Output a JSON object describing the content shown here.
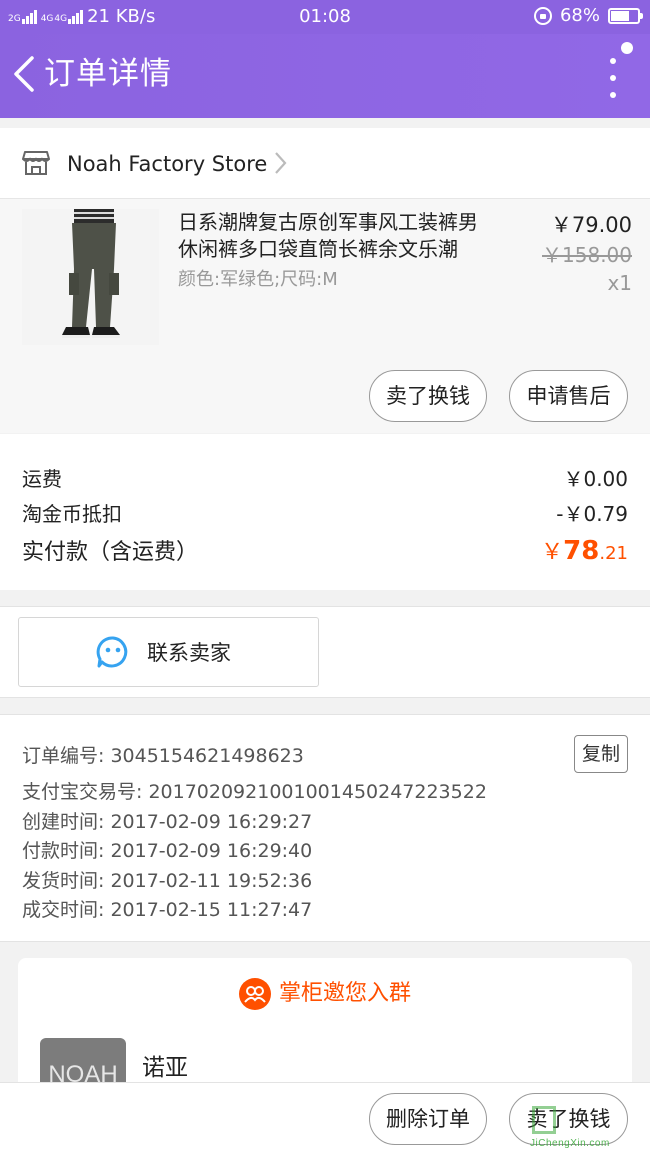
{
  "status_bar": {
    "net_label_1": "2G",
    "net_label_2": "4G",
    "net_label_3": "4G",
    "speed": "21 KB/s",
    "time": "01:08",
    "battery": "68%",
    "battery_level": 0.68
  },
  "header": {
    "title": "订单详情"
  },
  "store": {
    "name": "Noah Factory Store"
  },
  "product": {
    "title": "日系潮牌复古原创军事风工装裤男休闲裤多口袋直筒长裤余文乐潮",
    "sku": "颜色:军绿色;尺码:M",
    "price": "￥79.00",
    "original_price": "￥158.00",
    "quantity": "x1",
    "buttons": {
      "resell": "卖了换钱",
      "after_sale": "申请售后"
    }
  },
  "fees": {
    "shipping_label": "运费",
    "shipping_value": "￥0.00",
    "coin_label": "淘金币抵扣",
    "coin_value": "-￥0.79",
    "paid_label": "实付款（含运费）",
    "paid_currency": "￥",
    "paid_int": "78",
    "paid_dec": ".21"
  },
  "contact": {
    "label": "联系卖家"
  },
  "order_info": {
    "order_no": "订单编号: 3045154621498623",
    "alipay_no": "支付宝交易号: 2017020921001001450247223522",
    "created": "创建时间: 2017-02-09 16:29:27",
    "paid": "付款时间: 2017-02-09 16:29:40",
    "shipped": "发货时间: 2017-02-11 19:52:36",
    "completed": "成交时间: 2017-02-15 11:27:47",
    "copy_label": "复制"
  },
  "group": {
    "heading": "掌柜邀您入群",
    "avatar_text": "NOAH",
    "name": "诺亚"
  },
  "bottom_bar": {
    "delete": "删除订单",
    "resell": "卖了换钱"
  },
  "watermark": {
    "text": "JiChengXin.com"
  },
  "colors": {
    "header": "#8b63e0",
    "accent": "#ff5000",
    "contact_icon": "#36a3f0"
  }
}
